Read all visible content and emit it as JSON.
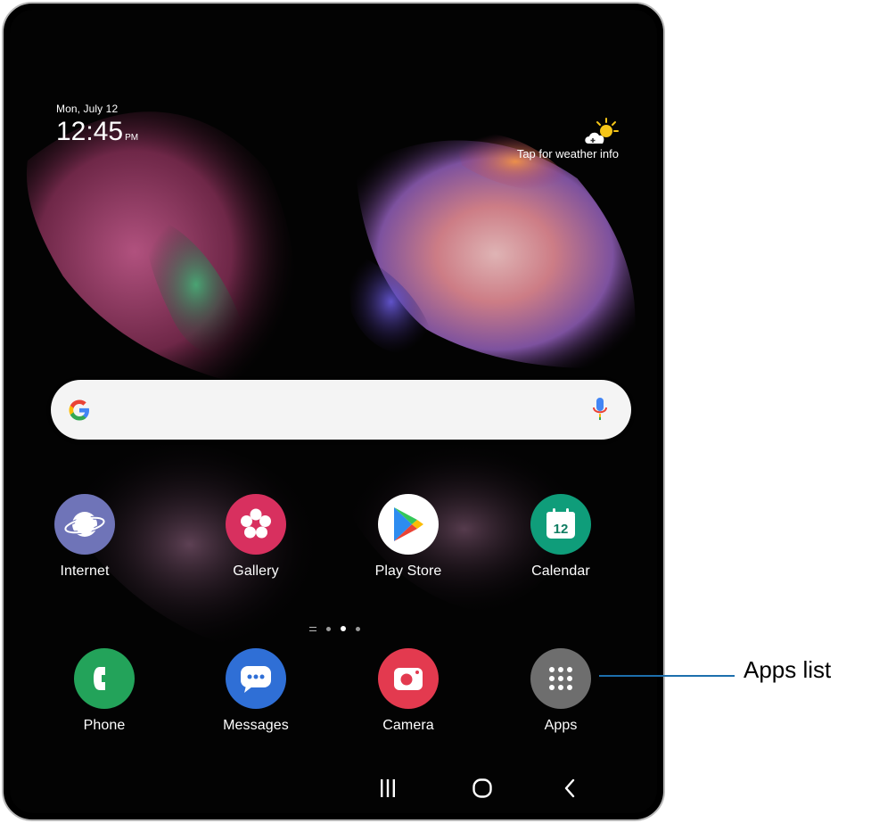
{
  "lockscreen": {
    "date": "Mon, July 12",
    "time": "12:45",
    "ampm": "PM"
  },
  "weather": {
    "icon": "sun-cloud-plus-icon",
    "label": "Tap for weather info"
  },
  "search_bar": {
    "logo": "google-g-icon",
    "mic": "microphone-icon"
  },
  "apps_row1": [
    {
      "label": "Internet",
      "icon": "internet-icon",
      "color": "#6f74b8"
    },
    {
      "label": "Gallery",
      "icon": "gallery-flower-icon",
      "color": "#d8305f"
    },
    {
      "label": "Play Store",
      "icon": "play-store-icon",
      "color": "#ffffff"
    },
    {
      "label": "Calendar",
      "icon": "calendar-icon",
      "color": "#0f9d7a",
      "day": "12"
    }
  ],
  "apps_row2": [
    {
      "label": "Phone",
      "icon": "phone-icon",
      "color": "#23a35a"
    },
    {
      "label": "Messages",
      "icon": "messages-icon",
      "color": "#2f6fd6"
    },
    {
      "label": "Camera",
      "icon": "camera-icon",
      "color": "#e33a4f"
    },
    {
      "label": "Apps",
      "icon": "apps-grid-icon",
      "color": "#6e6e6e"
    }
  ],
  "page_indicator": {
    "pages": 3,
    "active": 2
  },
  "nav": {
    "recents": "recents-icon",
    "home": "home-icon",
    "back": "back-icon"
  },
  "callout": {
    "label": "Apps list",
    "color": "#1d6fad"
  }
}
